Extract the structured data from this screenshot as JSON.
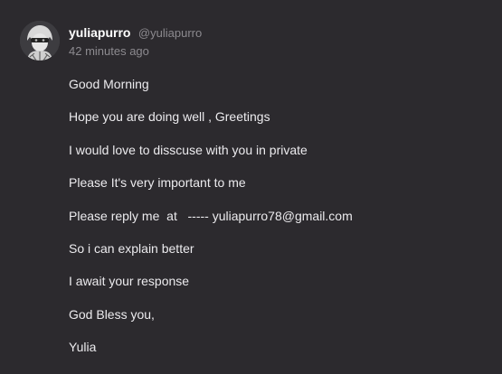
{
  "post": {
    "author": {
      "display_name": "yuliapurro",
      "handle": "@yuliapurro",
      "avatar_icon": "anime-character-avatar-icon"
    },
    "timestamp": "42 minutes ago",
    "lines": [
      "Good Morning",
      "Hope you are doing well , Greetings",
      "I would love to disscuse with you in private",
      "Please It's very important to me",
      "Please reply me  at   ----- yuliapurro78@gmail.com",
      "So i can explain better",
      "I await your response",
      "God Bless you,",
      "Yulia"
    ]
  },
  "colors": {
    "background": "#2c2a2e",
    "text": "#ecebee",
    "muted": "#8c8a8f",
    "name": "#ffffff"
  }
}
